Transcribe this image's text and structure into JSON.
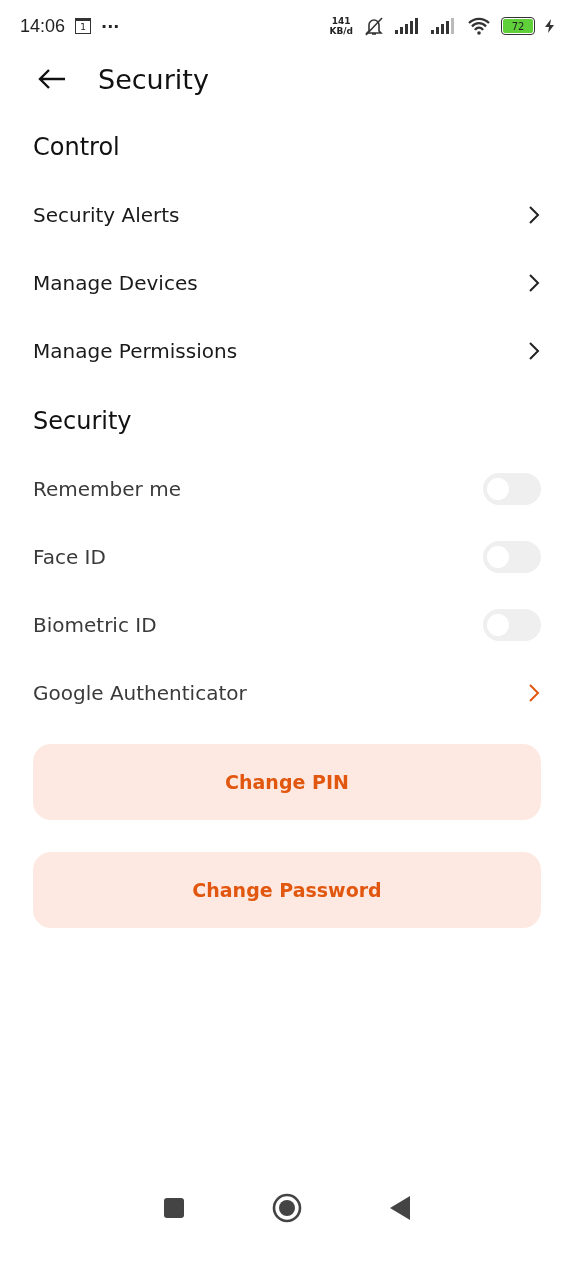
{
  "status_bar": {
    "time": "14:06",
    "calendar_day": "1",
    "more": "···",
    "speed": "141",
    "speed_unit": "KB/d",
    "battery": "72",
    "charging": true
  },
  "header": {
    "title": "Security"
  },
  "sections": [
    {
      "title": "Control",
      "rows": [
        {
          "kind": "link",
          "label": "Security Alerts",
          "accent": false
        },
        {
          "kind": "link",
          "label": "Manage Devices",
          "accent": false
        },
        {
          "kind": "link",
          "label": "Manage Permissions",
          "accent": false
        }
      ]
    },
    {
      "title": "Security",
      "rows": [
        {
          "kind": "toggle",
          "label": "Remember me",
          "on": false
        },
        {
          "kind": "toggle",
          "label": "Face ID",
          "on": false
        },
        {
          "kind": "toggle",
          "label": "Biometric ID",
          "on": false
        },
        {
          "kind": "link",
          "label": "Google Authenticator",
          "accent": true
        }
      ]
    }
  ],
  "buttons": [
    "Change PIN",
    "Change Password"
  ]
}
